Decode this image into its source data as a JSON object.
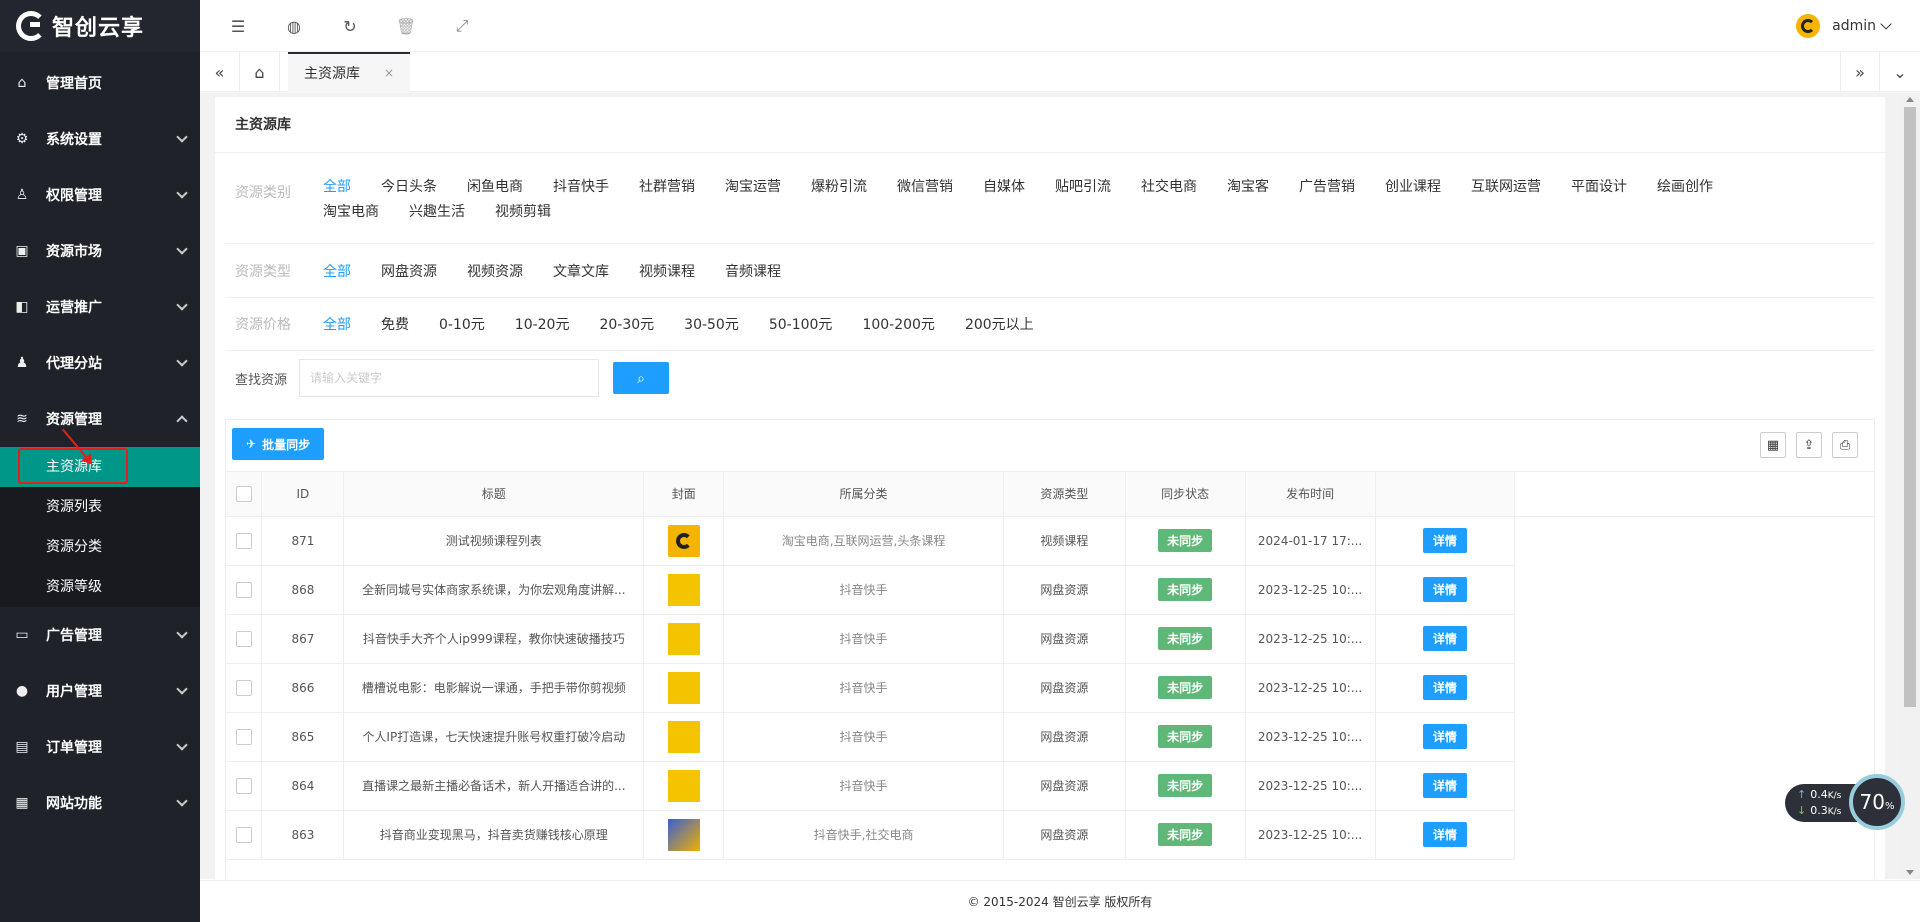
{
  "brand": {
    "name": "智创云享"
  },
  "sidebar": {
    "items": [
      {
        "label": "管理首页",
        "icon": "home-icon"
      },
      {
        "label": "系统设置",
        "icon": "gear-icon"
      },
      {
        "label": "权限管理",
        "icon": "permission-icon"
      },
      {
        "label": "资源市场",
        "icon": "market-icon"
      },
      {
        "label": "运营推广",
        "icon": "promo-icon"
      },
      {
        "label": "代理分站",
        "icon": "agent-icon"
      },
      {
        "label": "资源管理",
        "icon": "layers-icon"
      },
      {
        "label": "广告管理",
        "icon": "ad-icon"
      },
      {
        "label": "用户管理",
        "icon": "user-icon"
      },
      {
        "label": "订单管理",
        "icon": "order-icon"
      },
      {
        "label": "网站功能",
        "icon": "grid-icon"
      }
    ],
    "sub_items": [
      "主资源库",
      "资源列表",
      "资源分类",
      "资源等级"
    ]
  },
  "header": {
    "user": "admin"
  },
  "tabs": {
    "active": "主资源库",
    "close": "×"
  },
  "card": {
    "title": "主资源库"
  },
  "filters": {
    "category": {
      "label": "资源类别",
      "options": [
        "全部",
        "今日头条",
        "闲鱼电商",
        "抖音快手",
        "社群营销",
        "淘宝运营",
        "爆粉引流",
        "微信营销",
        "自媒体",
        "贴吧引流",
        "社交电商",
        "淘宝客",
        "广告营销",
        "创业课程",
        "互联网运营",
        "平面设计",
        "绘画创作",
        "淘宝电商",
        "兴趣生活",
        "视频剪辑"
      ]
    },
    "type": {
      "label": "资源类型",
      "options": [
        "全部",
        "网盘资源",
        "视频资源",
        "文章文库",
        "视频课程",
        "音频课程"
      ]
    },
    "price": {
      "label": "资源价格",
      "options": [
        "全部",
        "免费",
        "0-10元",
        "10-20元",
        "20-30元",
        "30-50元",
        "50-100元",
        "100-200元",
        "200元以上"
      ]
    }
  },
  "search": {
    "label": "查找资源",
    "placeholder": "请输入关键字"
  },
  "toolbar": {
    "batch_label": "批量同步"
  },
  "table": {
    "headers": [
      "ID",
      "标题",
      "封面",
      "所属分类",
      "资源类型",
      "同步状态",
      "发布时间"
    ],
    "rows": [
      {
        "id": "871",
        "title": "测试视频课程列表",
        "cat": "淘宝电商,互联网运营,头条课程",
        "type": "视频课程",
        "status": "未同步",
        "time": "2024-01-17 17:...",
        "action": "详情"
      },
      {
        "id": "868",
        "title": "全新同城号实体商家系统课，为你宏观角度讲解...",
        "cat": "抖音快手",
        "type": "网盘资源",
        "status": "未同步",
        "time": "2023-12-25 10:...",
        "action": "详情"
      },
      {
        "id": "867",
        "title": "抖音快手大齐个人ip999课程，教你快速破播技巧",
        "cat": "抖音快手",
        "type": "网盘资源",
        "status": "未同步",
        "time": "2023-12-25 10:...",
        "action": "详情"
      },
      {
        "id": "866",
        "title": "槽槽说电影：电影解说一课通，手把手带你剪视频",
        "cat": "抖音快手",
        "type": "网盘资源",
        "status": "未同步",
        "time": "2023-12-25 10:...",
        "action": "详情"
      },
      {
        "id": "865",
        "title": "个人IP打造课，七天快速提升账号权重打破冷启动",
        "cat": "抖音快手",
        "type": "网盘资源",
        "status": "未同步",
        "time": "2023-12-25 10:...",
        "action": "详情"
      },
      {
        "id": "864",
        "title": "直播课之最新主播必备话术，新人开播适合讲的...",
        "cat": "抖音快手",
        "type": "网盘资源",
        "status": "未同步",
        "time": "2023-12-25 10:...",
        "action": "详情"
      },
      {
        "id": "863",
        "title": "抖音商业变现黑马，抖音卖货赚钱核心原理",
        "cat": "抖音快手,社交电商",
        "type": "网盘资源",
        "status": "未同步",
        "time": "2023-12-25 10:...",
        "action": "详情"
      }
    ]
  },
  "footer": {
    "text": "© 2015-2024 智创云享 版权所有"
  },
  "speed": {
    "up": "0.4",
    "down": "0.3",
    "unit": "K/s",
    "percent": "70",
    "pct_sign": "%"
  }
}
